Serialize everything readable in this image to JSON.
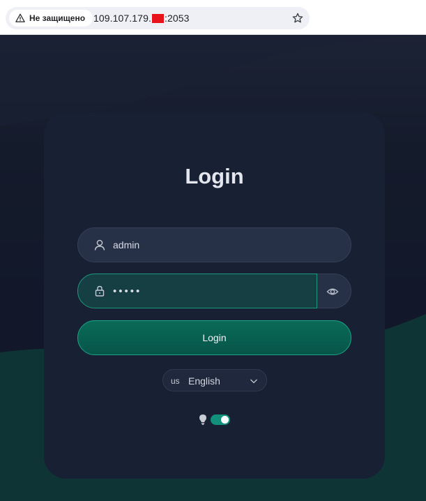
{
  "browser": {
    "security_label": "Не защищено",
    "url_prefix": "109.107.179.",
    "url_suffix": ":2053"
  },
  "login": {
    "title": "Login",
    "username_value": "admin",
    "password_value": "•••••",
    "button_label": "Login"
  },
  "language": {
    "flag_code": "us",
    "selected": "English"
  },
  "theme_toggle": {
    "on": true,
    "accent": "#11917b"
  },
  "colors": {
    "card_bg": "#182034",
    "accent": "#1ba487",
    "page_bg": "#121829"
  }
}
